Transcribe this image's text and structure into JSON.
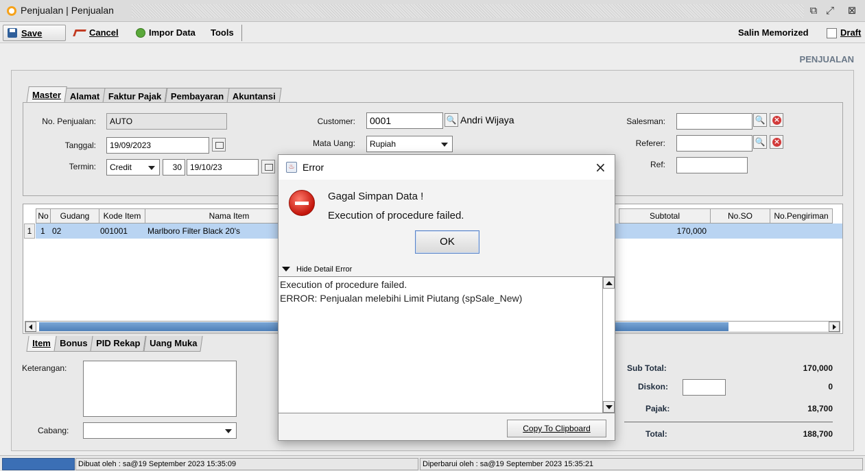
{
  "window": {
    "title": "Penjualan | Penjualan"
  },
  "toolbar": {
    "save": "Save",
    "cancel": "Cancel",
    "impor": "Impor Data",
    "tools": "Tools",
    "salin": "Salin Memorized",
    "draft": "Draft"
  },
  "page_heading": "PENJUALAN",
  "master_tabs": [
    "Master",
    "Alamat",
    "Faktur Pajak",
    "Pembayaran",
    "Akuntansi"
  ],
  "form": {
    "no_penjualan_label": "No. Penjualan:",
    "no_penjualan": "AUTO",
    "tanggal_label": "Tanggal:",
    "tanggal": "19/09/2023",
    "termin_label": "Termin:",
    "termin_type": "Credit",
    "termin_days": "30",
    "termin_date": "19/10/23",
    "customer_label": "Customer:",
    "customer_code": "0001",
    "customer_name": "Andri Wijaya",
    "mata_uang_label": "Mata Uang:",
    "mata_uang": "Rupiah",
    "salesman_label": "Salesman:",
    "referer_label": "Referer:",
    "ref_label": "Ref:"
  },
  "grid": {
    "headers": {
      "no": "No",
      "gudang": "Gudang",
      "kode": "Kode Item",
      "nama": "Nama Item",
      "subtotal": "Subtotal",
      "noso": "No.SO",
      "nopengiriman": "No.Pengiriman"
    },
    "rows": [
      {
        "row": "1",
        "no": "1",
        "gudang": "02",
        "kode": "001001",
        "nama": "Marlboro Filter Black 20's",
        "subtotal": "170,000"
      }
    ]
  },
  "item_tabs": [
    "Item",
    "Bonus",
    "PID Rekap",
    "Uang Muka"
  ],
  "bottom": {
    "keterangan_label": "Keterangan:",
    "cabang_label": "Cabang:"
  },
  "summary": {
    "sub_total_label": "Sub Total:",
    "sub_total": "170,000",
    "diskon_label": "Diskon:",
    "diskon": "0",
    "pajak_label": "Pajak:",
    "pajak": "18,700",
    "total_label": "Total:",
    "total": "188,700"
  },
  "dialog": {
    "title": "Error",
    "message_1": "Gagal Simpan Data !",
    "message_2": "Execution of procedure failed.",
    "ok": "OK",
    "detail_toggle": "Hide Detail Error",
    "detail_line_1": "Execution of procedure failed.",
    "detail_line_2": "ERROR: Penjualan melebihi Limit Piutang (spSale_New)",
    "copy": "Copy To Clipboard"
  },
  "status": {
    "dibuat": "Dibuat oleh : sa@19 September 2023  15:35:09",
    "diperbarui": "Diperbarui oleh : sa@19 September 2023  15:35:21"
  }
}
